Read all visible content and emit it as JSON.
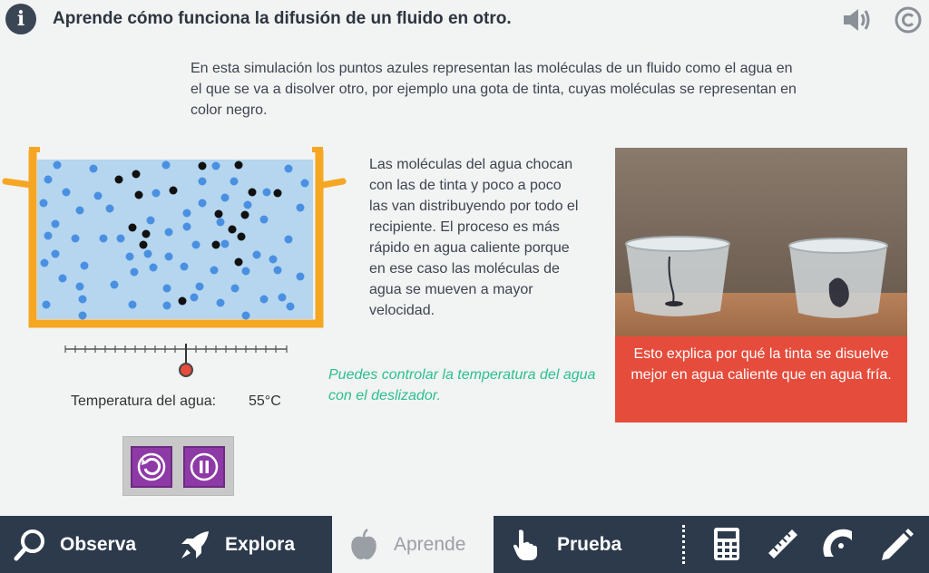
{
  "header": {
    "title": "Aprende cómo funciona la difusión de un fluido en otro.",
    "icons": [
      "info-icon",
      "speaker-icon",
      "copyright-icon"
    ]
  },
  "intro_text": "En esta simulación los puntos azules representan las moléculas de un fluido como el agua en el que se va a disolver otro, por ejemplo una gota de tinta, cuyas moléculas se representan en color negro.",
  "simulation": {
    "temperature_label": "Temperatura del agua:",
    "temperature_value": "55°C",
    "colors": {
      "water": "#b5d6ee",
      "container": "#f5a623",
      "water_molecule": "#4a90e2",
      "ink_molecule": "#111111",
      "slider_knob": "#e54c3c"
    },
    "controls": {
      "reset_icon": "reset-icon",
      "pause_icon": "pause-icon"
    }
  },
  "explanation_text": "Las moléculas del agua chocan con las de tinta y poco a poco las van distribuyendo por todo el recipiente.  El proceso es más rápido en agua caliente porque en ese caso las moléculas de agua se mueven a mayor velocidad.",
  "hint_text": "Puedes controlar la temperatura del agua con el deslizador.",
  "photo_caption": "Esto explica por qué la tinta se disuelve mejor en agua caliente que en agua fría.",
  "bottom_nav": {
    "items": [
      {
        "label": "Observa",
        "icon": "magnifier-icon"
      },
      {
        "label": "Explora",
        "icon": "rocket-icon"
      },
      {
        "label": "Aprende",
        "icon": "apple-icon",
        "active": true
      },
      {
        "label": "Prueba",
        "icon": "hand-pointer-icon"
      }
    ],
    "tools": [
      "calculator-icon",
      "ruler-icon",
      "protractor-icon",
      "pencil-icon"
    ]
  }
}
